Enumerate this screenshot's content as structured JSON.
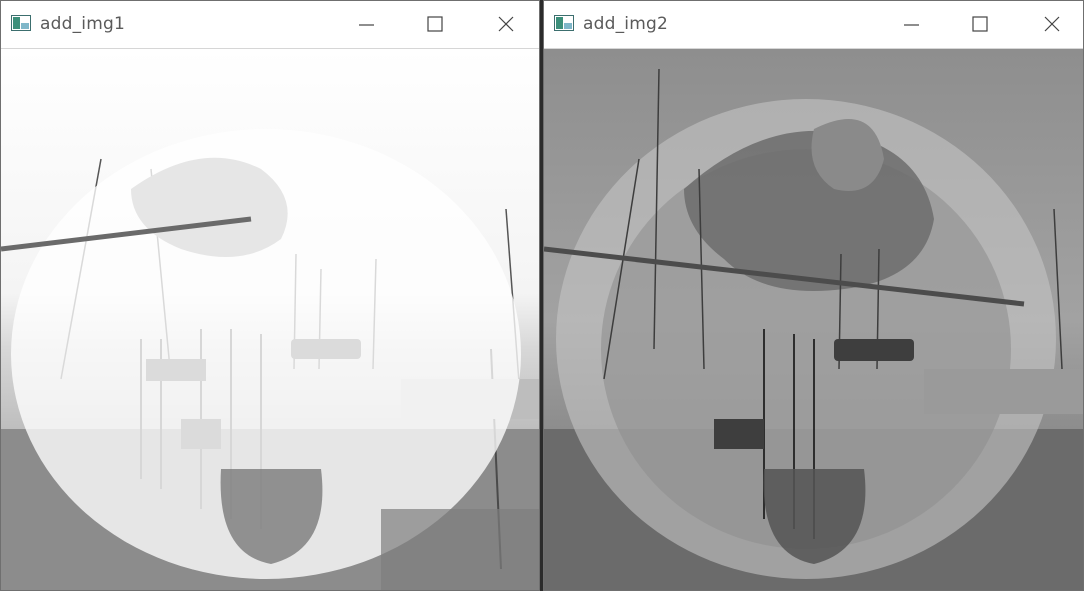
{
  "windows": [
    {
      "title": "add_img1"
    },
    {
      "title": "add_img2"
    }
  ],
  "icons": {
    "app": "opencv-window-icon",
    "minimize": "minimize-icon",
    "maximize": "maximize-icon",
    "close": "close-icon"
  }
}
